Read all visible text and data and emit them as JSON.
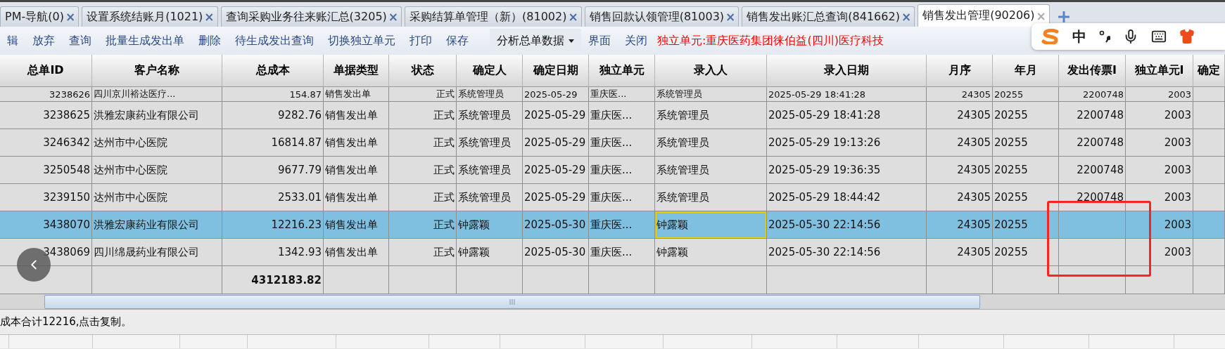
{
  "tabs": [
    {
      "label": "PM-导航(0)",
      "close": "×",
      "selected": false
    },
    {
      "label": "设置系统结账月(1021)",
      "close": "×",
      "selected": false
    },
    {
      "label": "查询采购业务往来账汇总(3205)",
      "close": "×",
      "selected": false
    },
    {
      "label": "采购结算单管理（新）(81002)",
      "close": "×",
      "selected": false
    },
    {
      "label": "销售回款认领管理(81003)",
      "close": "×",
      "selected": false
    },
    {
      "label": "销售发出账汇总查询(841662)",
      "close": "×",
      "selected": false
    },
    {
      "label": "销售发出管理(90206)",
      "close": "×",
      "selected": true
    }
  ],
  "toolbar": {
    "items": [
      {
        "label": "辑",
        "kind": "button"
      },
      {
        "label": "放弃",
        "kind": "button"
      },
      {
        "label": "查询",
        "kind": "button"
      },
      {
        "label": "批量生成发出单",
        "kind": "button"
      },
      {
        "label": "删除",
        "kind": "button"
      },
      {
        "label": "待生成发出查询",
        "kind": "button"
      },
      {
        "label": "切换独立单元",
        "kind": "button"
      },
      {
        "label": "打印",
        "kind": "button"
      },
      {
        "label": "保存",
        "kind": "button"
      },
      {
        "label": "分析总单数据",
        "kind": "dropdown"
      },
      {
        "label": "界面",
        "kind": "button"
      },
      {
        "label": "关闭",
        "kind": "button"
      }
    ],
    "unit_text": "独立单元:重庆医药集团徕伯益(四川)医疗科技"
  },
  "ime_toolbar": {
    "mode": "中"
  },
  "table": {
    "columns": [
      "总单ID",
      "客户名称",
      "总成本",
      "单据类型",
      "状态",
      "确定人",
      "确定日期",
      "独立单元",
      "录入人",
      "录入日期",
      "月序",
      "年月",
      "发出传票I",
      "独立单元I",
      "确定"
    ],
    "rows": [
      {
        "selected": false,
        "editing": false,
        "cells": [
          "3238626",
          "四川京川裕达医疗...",
          "154.87",
          "销售发出单",
          "正式",
          "系统管理员",
          "2025-05-29",
          "重庆医...",
          "系统管理员",
          "2025-05-29 18:41:28",
          "24305",
          "20255",
          "2200748",
          "2003"
        ]
      },
      {
        "selected": false,
        "editing": false,
        "cells": [
          "3238625",
          "洪雅宏康药业有限公司",
          "9282.76",
          "销售发出单",
          "正式",
          "系统管理员",
          "2025-05-29",
          "重庆医...",
          "系统管理员",
          "2025-05-29 18:41:28",
          "24305",
          "20255",
          "2200748",
          "2003"
        ]
      },
      {
        "selected": false,
        "editing": false,
        "cells": [
          "3246342",
          "达州市中心医院",
          "16814.87",
          "销售发出单",
          "正式",
          "系统管理员",
          "2025-05-29",
          "重庆医...",
          "系统管理员",
          "2025-05-29 19:13:26",
          "24305",
          "20255",
          "2200748",
          "2003"
        ]
      },
      {
        "selected": false,
        "editing": false,
        "cells": [
          "3250548",
          "达州市中心医院",
          "9677.79",
          "销售发出单",
          "正式",
          "系统管理员",
          "2025-05-29",
          "重庆医...",
          "系统管理员",
          "2025-05-29 19:36:35",
          "24305",
          "20255",
          "2200748",
          "2003"
        ]
      },
      {
        "selected": false,
        "editing": false,
        "cells": [
          "3239150",
          "达州市中心医院",
          "2533.01",
          "销售发出单",
          "正式",
          "系统管理员",
          "2025-05-29",
          "重庆医...",
          "系统管理员",
          "2025-05-29 18:44:42",
          "24305",
          "20255",
          "2200748",
          "2003"
        ]
      },
      {
        "selected": true,
        "editing": true,
        "cells": [
          "3438070",
          "洪雅宏康药业有限公司",
          "12216.23",
          "销售发出单",
          "正式",
          "钟露颖",
          "2025-05-30",
          "重庆医...",
          "钟露颖",
          "2025-05-30 22:14:56",
          "24305",
          "20255",
          null,
          "2003"
        ]
      },
      {
        "selected": false,
        "editing": false,
        "cells": [
          "3438069",
          "四川绵晟药业有限公司",
          "1342.93",
          "销售发出单",
          "正式",
          "钟露颖",
          "2025-05-30",
          "重庆医...",
          "钟露颖",
          "2025-05-30 22:14:56",
          "24305",
          "20255",
          null,
          "2003"
        ]
      }
    ],
    "total_cost": "4312183.82"
  },
  "status_bar": {
    "text": "成本合计12216,点击复制。"
  }
}
